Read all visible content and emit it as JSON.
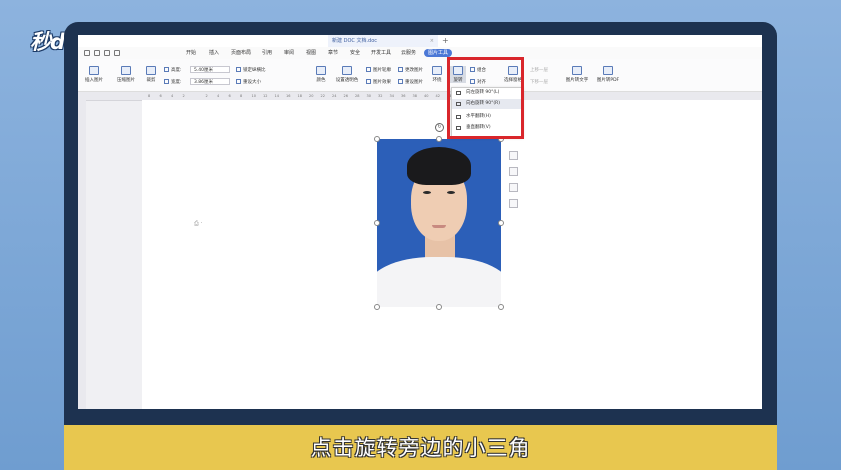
{
  "branding": {
    "logo": "秒dong视频"
  },
  "window": {
    "doc_tab": "新建 DOC 文档.doc",
    "tab_close": "×",
    "tab_add": "+"
  },
  "menu": {
    "items": [
      "开始",
      "插入",
      "页面布局",
      "引用",
      "审阅",
      "视图",
      "章节",
      "安全",
      "开发工具",
      "云服务"
    ],
    "active": "图片工具"
  },
  "ribbon": {
    "insert_picture": "插入图片",
    "compress_picture": "压缩图片",
    "crop": "裁剪",
    "height_label": "高度:",
    "height_value": "5.40厘米",
    "width_label": "宽度:",
    "width_value": "3.86厘米",
    "lock_ratio": "锁定纵横比",
    "reset_size": "重设大小",
    "color": "颜色",
    "set_transparent": "设置透明色",
    "picture_outline": "图片轮廓",
    "picture_effect": "图片效果",
    "change_picture": "更改图片",
    "reset_picture": "重设图片",
    "wrap": "环绕",
    "rotate": "旋转",
    "group": "组合",
    "align": "对齐",
    "selection_pane": "选择窗格",
    "up_one": "上移一层",
    "down_one": "下移一层",
    "picture_to_text": "图片转文字",
    "picture_to_pdf": "图片转PDF"
  },
  "rotate_menu": {
    "items": [
      "向左旋转 90°(L)",
      "向右旋转 90°(R)",
      "水平翻转(H)",
      "垂直翻转(V)"
    ],
    "highlighted_index": 1
  },
  "ruler": {
    "ticks": [
      "8",
      "6",
      "4",
      "2",
      "",
      "2",
      "4",
      "6",
      "8",
      "10",
      "12",
      "14",
      "16",
      "18",
      "20",
      "22",
      "24",
      "26",
      "28",
      "30",
      "32",
      "34",
      "36",
      "38",
      "40",
      "42",
      "44",
      "46"
    ]
  },
  "subtitle": "点击旋转旁边的小三角"
}
